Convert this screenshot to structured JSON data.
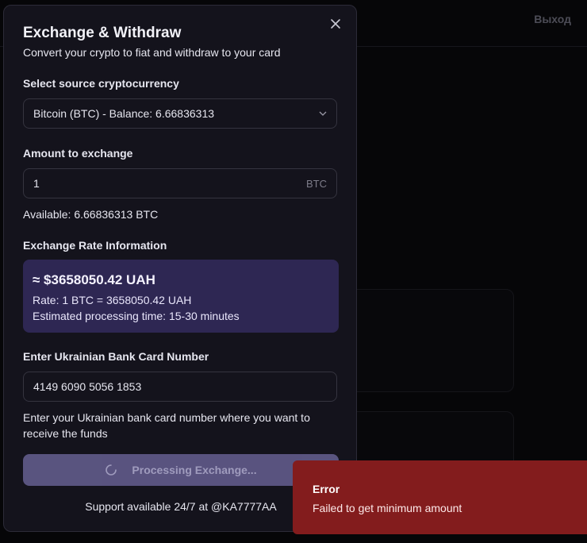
{
  "background": {
    "logout_label": "Выход"
  },
  "modal": {
    "close_icon": "close-icon",
    "title": "Exchange & Withdraw",
    "subtitle": "Convert your crypto to fiat and withdraw to your card",
    "source": {
      "label": "Select source cryptocurrency",
      "selected": "Bitcoin (BTC) - Balance: 6.66836313",
      "icon": "chevron-down-icon"
    },
    "amount": {
      "label": "Amount to exchange",
      "value": "1",
      "unit": "BTC",
      "available": "Available: 6.66836313 BTC"
    },
    "rate": {
      "label": "Exchange Rate Information",
      "amount": "≈ $3658050.42 UAH",
      "rate_line": "Rate: 1 BTC = 3658050.42 UAH",
      "time_line": "Estimated processing time: 15-30 minutes",
      "box_color": "#2e2753"
    },
    "card": {
      "label": "Enter Ukrainian Bank Card Number",
      "value": "4149 6090 5056 1853",
      "helper": "Enter your Ukrainian bank card number where you want to receive the funds"
    },
    "submit": {
      "label": "Processing Exchange...",
      "icon": "spinner-icon"
    },
    "support": "Support available 24/7 at @KA7777AA"
  },
  "toast": {
    "title": "Error",
    "message": "Failed to get minimum amount",
    "color": "#831c1d"
  }
}
